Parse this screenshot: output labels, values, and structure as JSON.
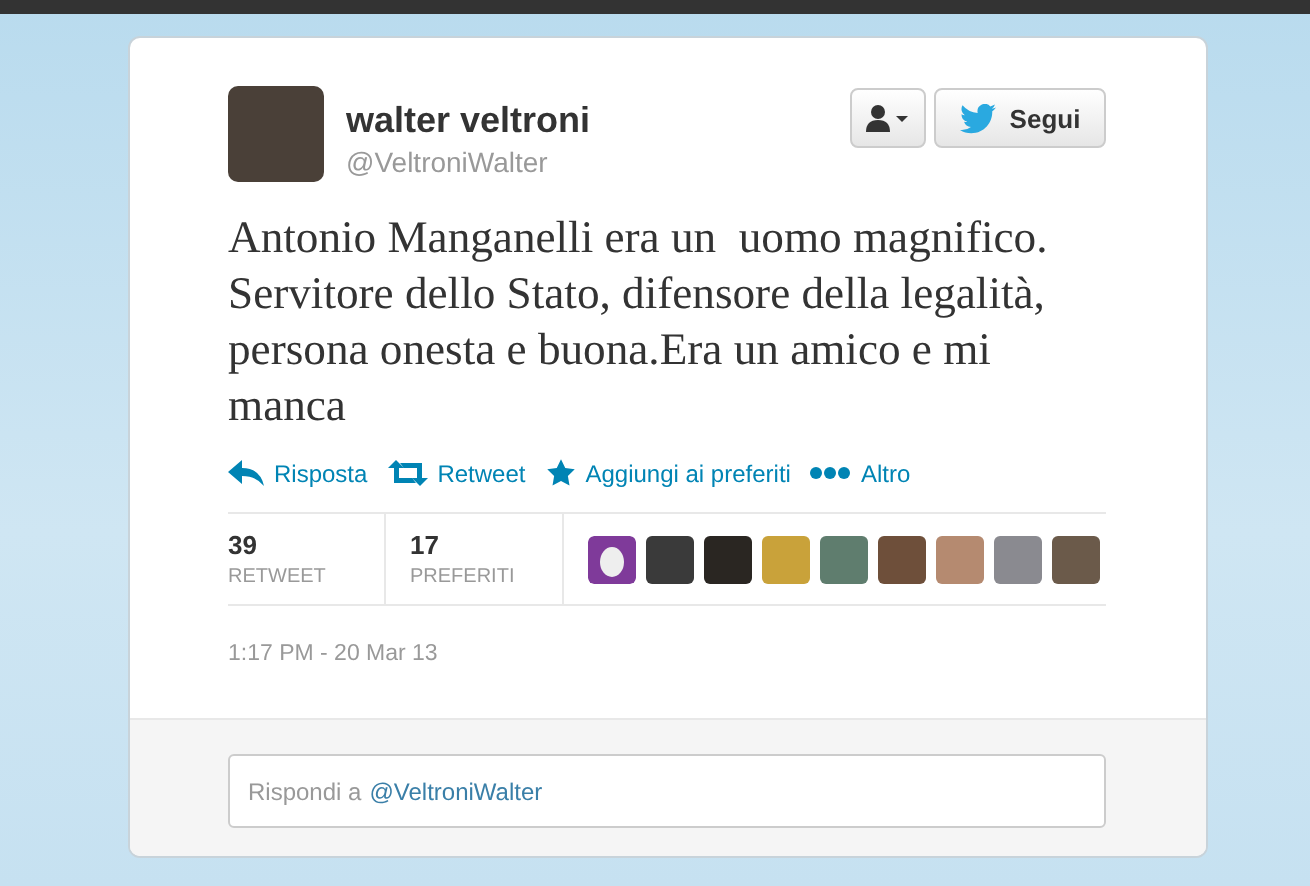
{
  "author": {
    "name": "walter veltroni",
    "handle": "@VeltroniWalter"
  },
  "follow_button": {
    "label": "Segui"
  },
  "tweet_text": "Antonio Manganelli era un  uomo magnifico. Servitore dello Stato, difensore della legalità, persona onesta e buona.Era un amico e mi manca",
  "actions": [
    {
      "kind": "reply",
      "label": "Risposta"
    },
    {
      "kind": "retweet",
      "label": "Retweet"
    },
    {
      "kind": "favorite",
      "label": "Aggiungi ai preferiti"
    },
    {
      "kind": "more",
      "label": "Altro"
    }
  ],
  "stats": [
    {
      "count": "39",
      "label": "RETWEET"
    },
    {
      "count": "17",
      "label": "PREFERITI"
    }
  ],
  "favoriters": [
    {
      "kind": "egg"
    },
    {
      "kind": "photo"
    },
    {
      "kind": "photo"
    },
    {
      "kind": "photo"
    },
    {
      "kind": "photo"
    },
    {
      "kind": "photo"
    },
    {
      "kind": "photo"
    },
    {
      "kind": "photo"
    },
    {
      "kind": "photo"
    }
  ],
  "timestamp": "1:17 PM - 20 Mar 13",
  "reply_field": {
    "placeholder": "Rispondi a",
    "mention": "@VeltroniWalter"
  }
}
